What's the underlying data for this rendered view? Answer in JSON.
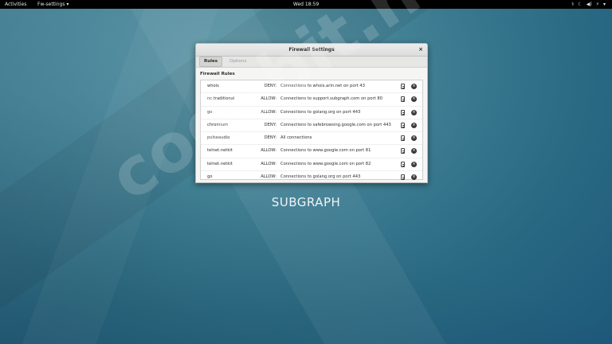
{
  "topbar": {
    "activities": "Activities",
    "app_menu": "Fw-settings ▾",
    "clock": "Wed 18:59",
    "tray": [
      "⚕",
      "☾",
      "◀)",
      "⚡",
      "▾"
    ]
  },
  "window": {
    "title": "Firewall Settings",
    "close_glyph": "×",
    "tabs": [
      {
        "label": "Rules",
        "active": true
      },
      {
        "label": "Options",
        "active": false
      }
    ],
    "section_title": "Firewall Rules",
    "rules": [
      {
        "app": "whois",
        "verdict": "DENY:",
        "desc": "Connections to whois.arin.net on port 43"
      },
      {
        "app": "nc.traditional",
        "verdict": "ALLOW:",
        "desc": "Connections to support.subgraph.com on port 80"
      },
      {
        "app": "go",
        "verdict": "ALLOW:",
        "desc": "Connections to golang.org on port 443"
      },
      {
        "app": "chromium",
        "verdict": "DENY:",
        "desc": "Connections to safebrowsing.google.com on port 443"
      },
      {
        "app": "pulseaudio",
        "verdict": "DENY:",
        "desc": "All connections"
      },
      {
        "app": "telnet.netkit",
        "verdict": "ALLOW:",
        "desc": "Connections to www.google.com on port 81"
      },
      {
        "app": "telnet.netkit",
        "verdict": "ALLOW:",
        "desc": "Connections to www.google.com on port 82"
      },
      {
        "app": "go",
        "verdict": "ALLOW:",
        "desc": "Connections to golang.org on port 443"
      }
    ],
    "delete_glyph": "×"
  },
  "desktop": {
    "brand": "SUBGRAPH",
    "watermark": "codebit.net"
  }
}
